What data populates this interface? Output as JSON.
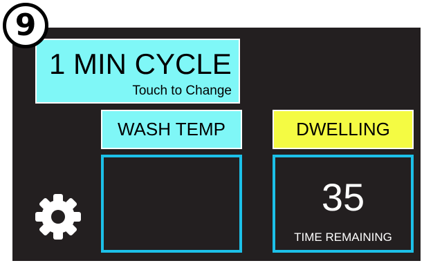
{
  "step": {
    "number": "9"
  },
  "cycle": {
    "title": "1 MIN CYCLE",
    "hint": "Touch to Change"
  },
  "wash": {
    "label": "WASH TEMP",
    "value": ""
  },
  "status": {
    "label": "DWELLING"
  },
  "timer": {
    "value": "35",
    "caption": "TIME REMAINING"
  },
  "icons": {
    "settings": "gear-icon"
  },
  "colors": {
    "screen_bg": "#231f20",
    "cyan_fill": "#7ff7f7",
    "yellow_fill": "#f4fb43",
    "outline_blue": "#1cc0e8",
    "text_white": "#ffffff"
  }
}
